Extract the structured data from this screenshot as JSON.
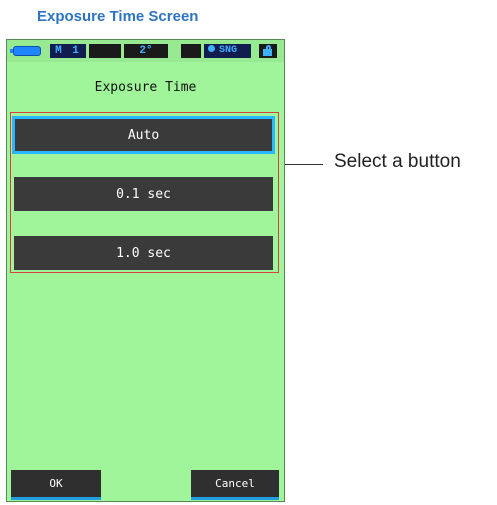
{
  "caption": "Exposure Time Screen",
  "status_bar": {
    "mode": "M 1",
    "angle": "2°",
    "shot_mode": "SNG",
    "icons": [
      "battery-icon",
      "dot-icon",
      "lock-icon"
    ]
  },
  "screen": {
    "title": "Exposure Time",
    "options": [
      {
        "label": "Auto",
        "selected": true
      },
      {
        "label": "0.1 sec",
        "selected": false
      },
      {
        "label": "1.0 sec",
        "selected": false
      }
    ],
    "ok_label": "OK",
    "cancel_label": "Cancel"
  },
  "callout": "Select a button",
  "colors": {
    "screen_bg": "#a0f59a",
    "button_bg": "#3a3a3a",
    "highlight": "#2ab6ff",
    "group_border": "#d64040",
    "caption": "#2e74c0"
  }
}
